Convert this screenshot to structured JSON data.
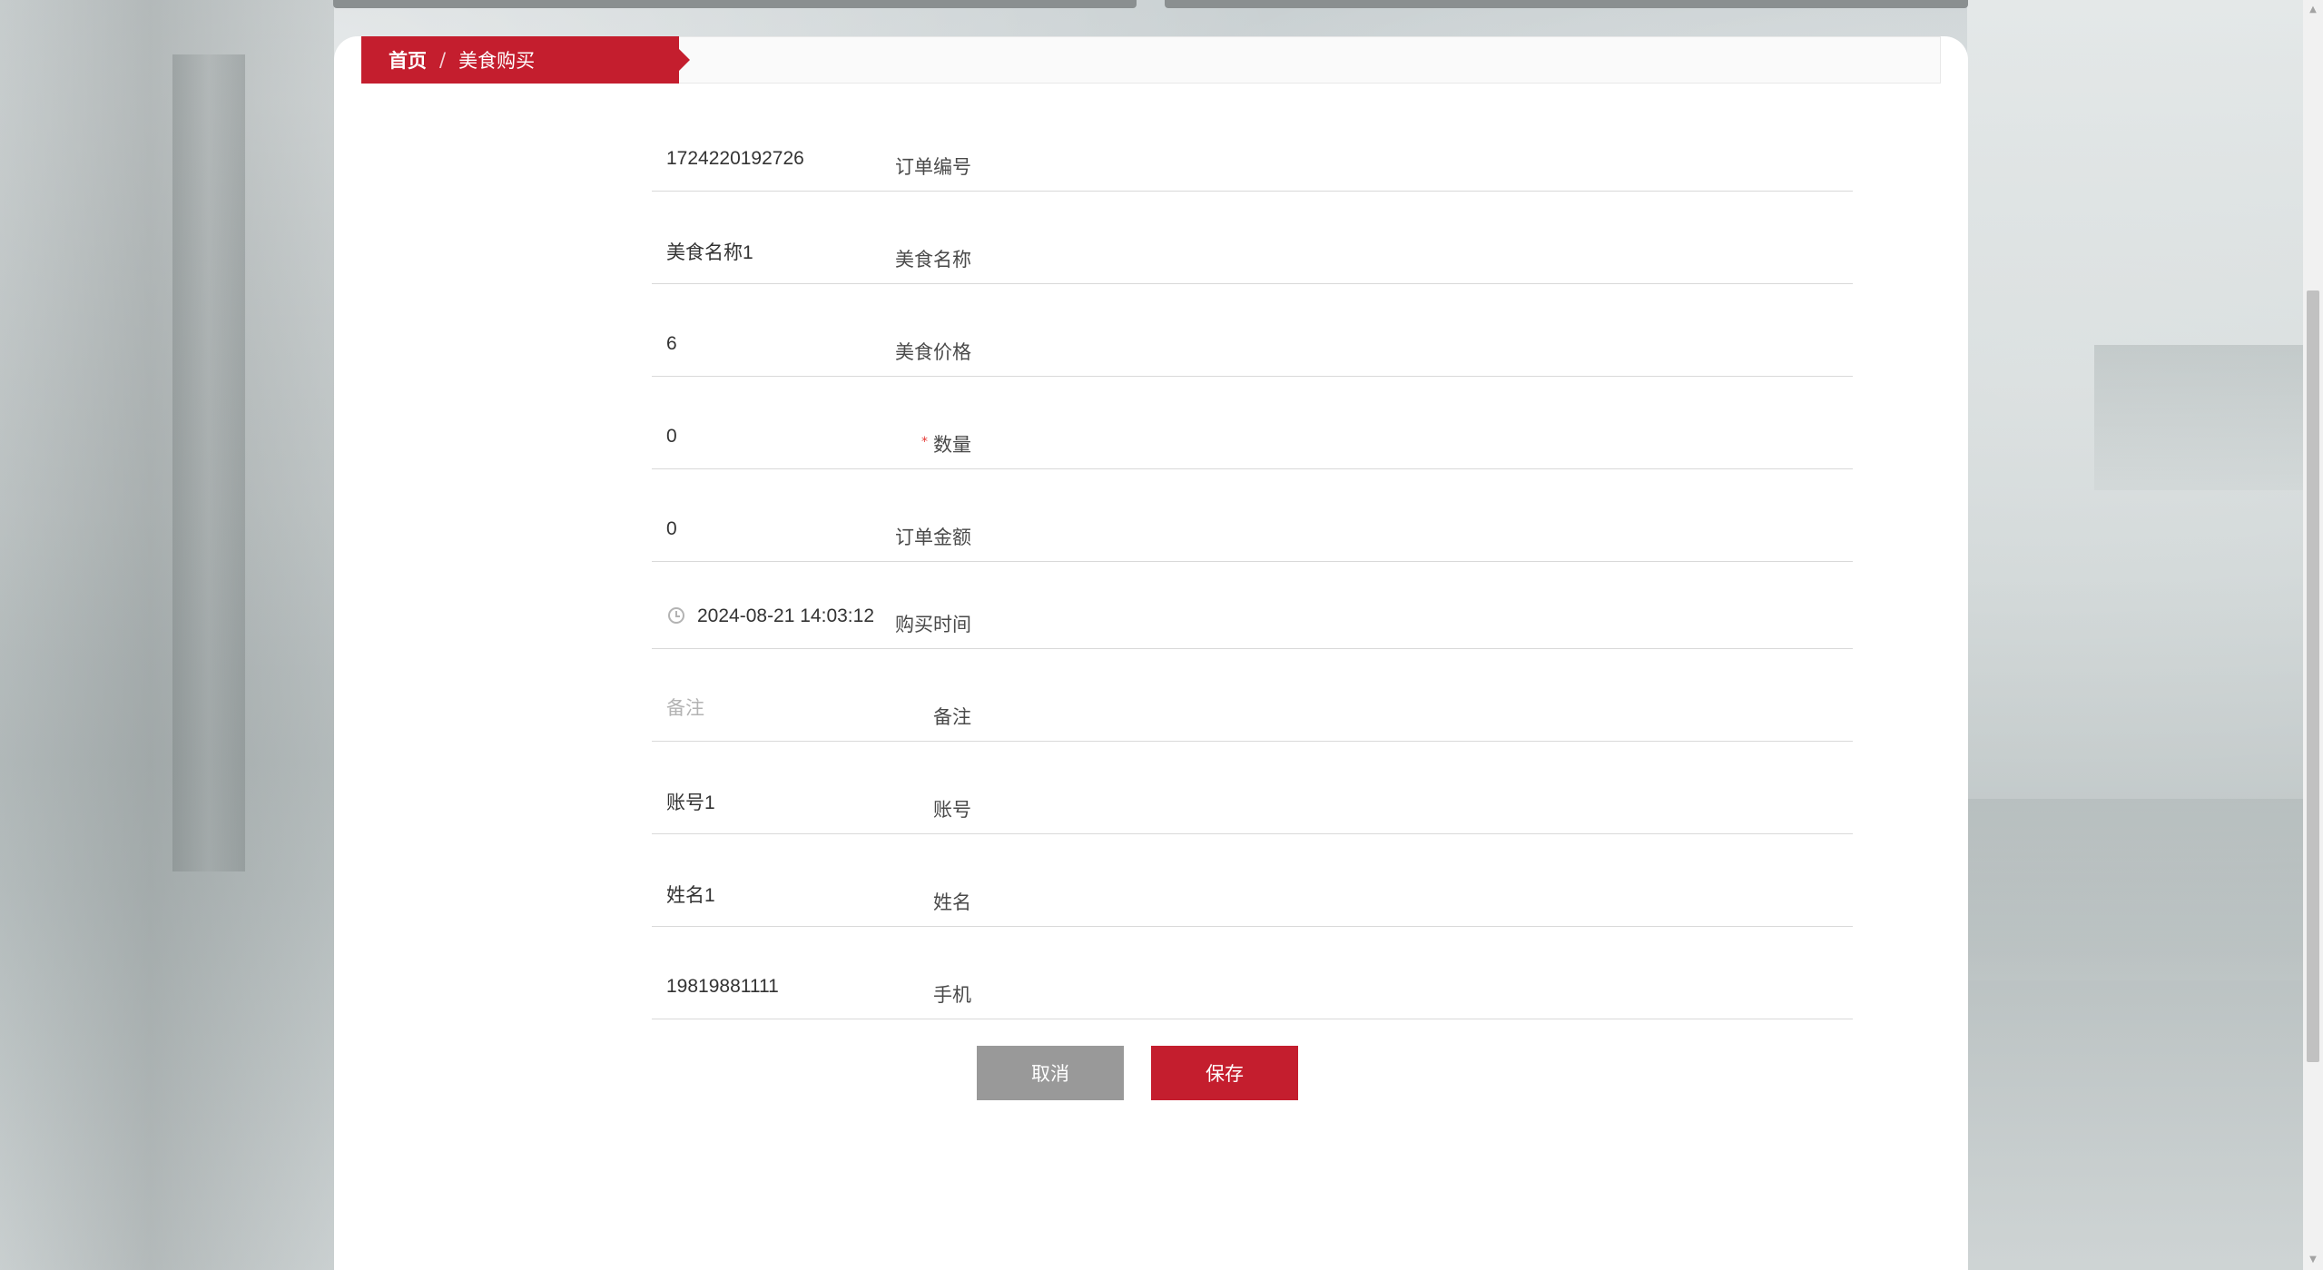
{
  "breadcrumb": {
    "home": "首页",
    "separator": "/",
    "current": "美食购买"
  },
  "form": {
    "fields": [
      {
        "label": "订单编号",
        "value": "1724220192726",
        "placeholder": "",
        "required": false
      },
      {
        "label": "美食名称",
        "value": "美食名称1",
        "placeholder": "",
        "required": false
      },
      {
        "label": "美食价格",
        "value": "6",
        "placeholder": "",
        "required": false
      },
      {
        "label": "数量",
        "value": "0",
        "placeholder": "",
        "required": true,
        "required_mark": "*"
      },
      {
        "label": "订单金额",
        "value": "0",
        "placeholder": "",
        "required": false
      },
      {
        "label": "购买时间",
        "value": "2024-08-21 14:03:12",
        "placeholder": "",
        "required": false,
        "icon": "clock-icon"
      },
      {
        "label": "备注",
        "value": "",
        "placeholder": "备注",
        "required": false
      },
      {
        "label": "账号",
        "value": "账号1",
        "placeholder": "",
        "required": false
      },
      {
        "label": "姓名",
        "value": "姓名1",
        "placeholder": "",
        "required": false
      },
      {
        "label": "手机",
        "value": "19819881111",
        "placeholder": "",
        "required": false
      }
    ]
  },
  "buttons": {
    "cancel": "取消",
    "save": "保存"
  },
  "colors": {
    "accent": "#c41e2e",
    "cancel": "#999999",
    "required": "#e53935"
  }
}
